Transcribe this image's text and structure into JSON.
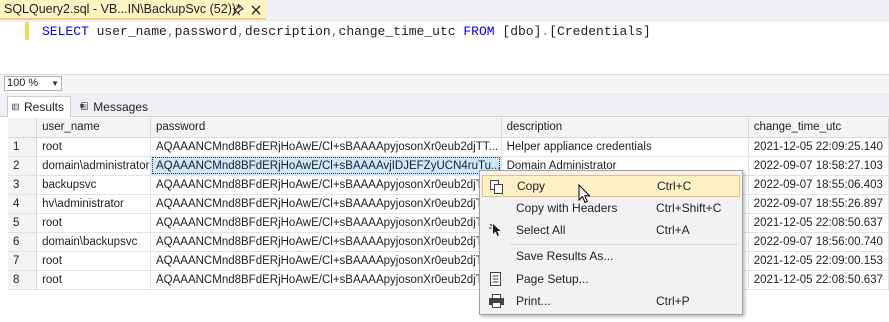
{
  "window": {
    "tab_title": "SQLQuery2.sql - VB...IN\\BackupSvc (52))*",
    "pin_icon": "pin-icon",
    "close_icon": "close-icon"
  },
  "editor": {
    "tokens": {
      "select": "SELECT",
      "col1": "user_name",
      "comma1": ",",
      "col2": "password",
      "comma2": ",",
      "col3": "description",
      "comma3": ",",
      "col4": "change_time_utc",
      "from": "FROM",
      "schema": "[dbo]",
      "dot": ".",
      "table": "[Credentials]"
    },
    "margin_color": "#f2d95c"
  },
  "zoom": {
    "value": "100 %"
  },
  "result_tabs": [
    {
      "label": "Results",
      "icon": "grid-icon"
    },
    {
      "label": "Messages",
      "icon": "messages-icon"
    }
  ],
  "grid": {
    "columns": [
      "",
      "user_name",
      "password",
      "description",
      "change_time_utc"
    ],
    "rows": [
      [
        "1",
        "root",
        "AQAAANCMnd8BFdERjHoAwE/Cl+sBAAAApyjosonXr0eub2djTT...",
        "Helper appliance credentials",
        "2021-12-05 22:09:25.140"
      ],
      [
        "2",
        "domain\\administrator",
        "AQAAANCMnd8BFdERjHoAwE/Cl+sBAAAAvjIDJEFZyUCN4ruTu...",
        "Domain Administrator",
        "2022-09-07 18:58:27.103"
      ],
      [
        "3",
        "backupsvc",
        "AQAAANCMnd8BFdERjHoAwE/Cl+sBAAAApyjosonXr0eub2djTT...",
        "",
        "2022-09-07 18:55:06.403"
      ],
      [
        "4",
        "hv\\administrator",
        "AQAAANCMnd8BFdERjHoAwE/Cl+sBAAAApyjosonXr0eub2djTT...",
        "",
        "2022-09-07 18:55:26.897"
      ],
      [
        "5",
        "root",
        "AQAAANCMnd8BFdERjHoAwE/Cl+sBAAAApyjosonXr0eub2djTT...",
        "",
        "2021-12-05 22:08:50.637"
      ],
      [
        "6",
        "domain\\backupsvc",
        "AQAAANCMnd8BFdERjHoAwE/Cl+sBAAAApyjosonXr0eub2djTT...",
        "",
        "2022-09-07 18:56:00.740"
      ],
      [
        "7",
        "root",
        "AQAAANCMnd8BFdERjHoAwE/Cl+sBAAAApyjosonXr0eub2djTT...",
        "",
        "2021-12-05 22:09:00.153"
      ],
      [
        "8",
        "root",
        "AQAAANCMnd8BFdERjHoAwE/Cl+sBAAAApyjosonXr0eub2djTT...",
        "",
        "2021-12-05 22:08:50.637"
      ]
    ],
    "selection_color": "#cce8ff"
  },
  "context_menu": {
    "items": [
      {
        "label": "Copy",
        "shortcut": "Ctrl+C",
        "icon": "copy-icon"
      },
      {
        "label": "Copy with Headers",
        "shortcut": "Ctrl+Shift+C",
        "icon": ""
      },
      {
        "label": "Select All",
        "shortcut": "Ctrl+A",
        "icon": "select-all-icon"
      },
      {
        "label": "Save Results As...",
        "shortcut": "",
        "icon": ""
      },
      {
        "label": "Page Setup...",
        "shortcut": "",
        "icon": "page-setup-icon"
      },
      {
        "label": "Print...",
        "shortcut": "Ctrl+P",
        "icon": "print-icon"
      }
    ],
    "hover_color": "#fef1c8"
  }
}
